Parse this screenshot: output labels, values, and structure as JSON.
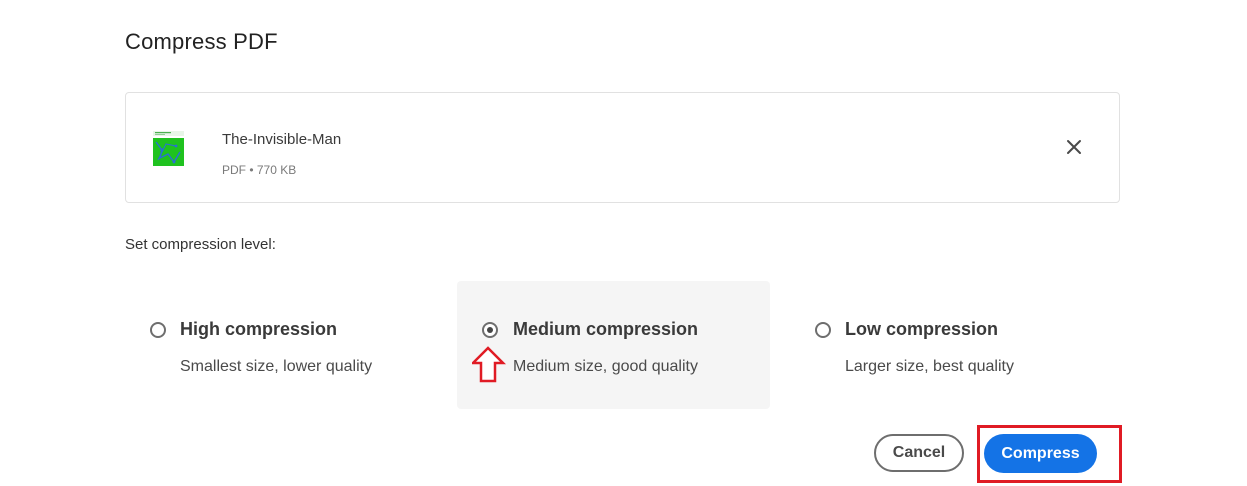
{
  "dialog": {
    "title": "Compress PDF"
  },
  "file": {
    "name": "The-Invisible-Man",
    "meta": "PDF • 770 KB",
    "thumbnail_icon": "pdf-thumbnail-icon",
    "remove_icon": "close-icon"
  },
  "compression": {
    "label": "Set compression level:",
    "selected": "medium",
    "options": [
      {
        "id": "high",
        "title": "High compression",
        "description": "Smallest size, lower quality",
        "selected": false
      },
      {
        "id": "medium",
        "title": "Medium compression",
        "description": "Medium size, good quality",
        "selected": true
      },
      {
        "id": "low",
        "title": "Low compression",
        "description": "Larger size, best quality",
        "selected": false
      }
    ]
  },
  "actions": {
    "cancel_label": "Cancel",
    "compress_label": "Compress"
  },
  "colors": {
    "primary": "#1473e6",
    "annotation": "#e01b24",
    "selected_bg": "#f5f5f5"
  }
}
